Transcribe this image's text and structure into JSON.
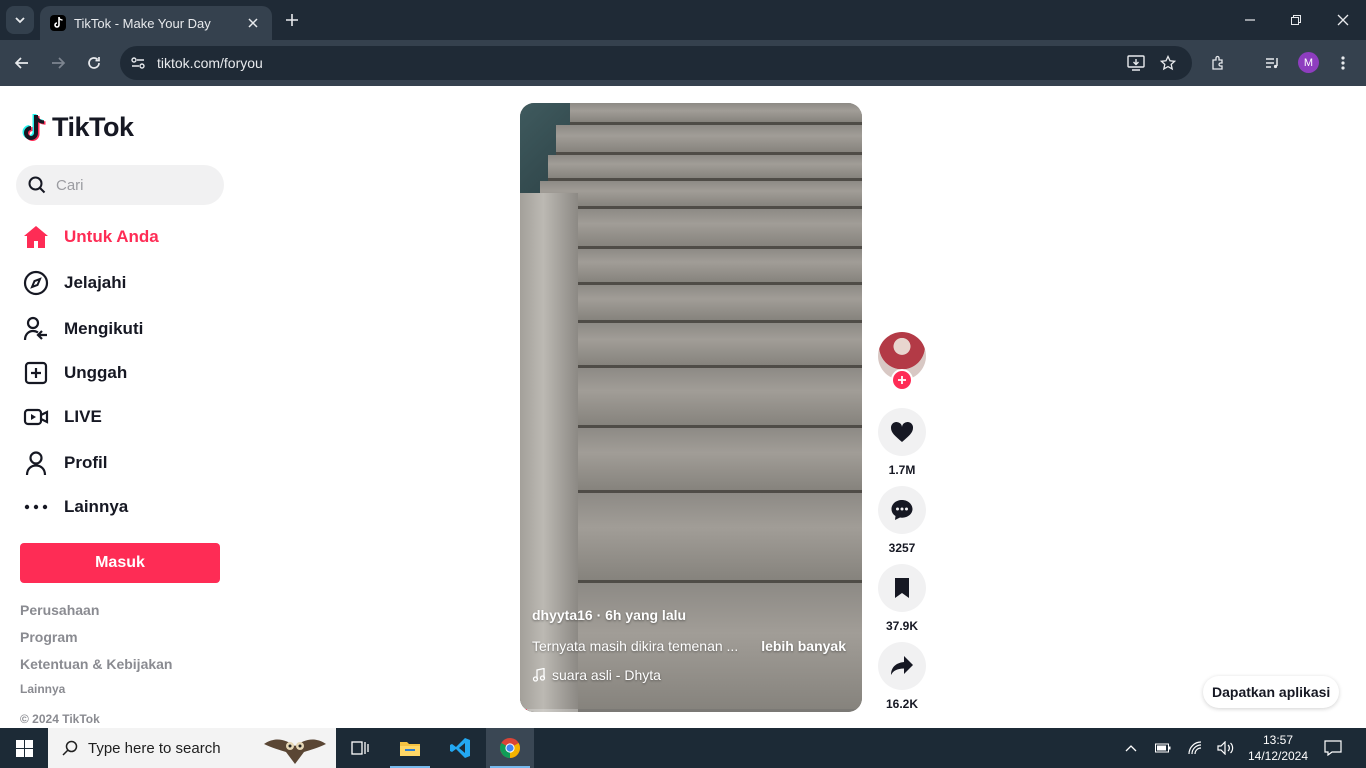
{
  "browser": {
    "tab_title": "TikTok - Make Your Day",
    "url": "tiktok.com/foryou",
    "profile_initial": "M"
  },
  "sidebar": {
    "logo_text": "TikTok",
    "search_placeholder": "Cari",
    "items": [
      {
        "label": "Untuk Anda",
        "icon": "home-icon",
        "active": true
      },
      {
        "label": "Jelajahi",
        "icon": "compass-icon"
      },
      {
        "label": "Mengikuti",
        "icon": "following-icon"
      },
      {
        "label": "Unggah",
        "icon": "upload-icon"
      },
      {
        "label": "LIVE",
        "icon": "live-icon"
      },
      {
        "label": "Profil",
        "icon": "profile-icon"
      },
      {
        "label": "Lainnya",
        "icon": "more-icon"
      }
    ],
    "login_label": "Masuk",
    "footer_links": [
      "Perusahaan",
      "Program",
      "Ketentuan & Kebijakan"
    ],
    "footer_more": "Lainnya",
    "copyright": "© 2024 TikTok"
  },
  "video": {
    "author_line": "dhyyta16 · 6h yang lalu",
    "description": "Ternyata masih dikira temenan ...",
    "more_label": "lebih banyak",
    "music": "suara asli - Dhyta",
    "progress": 0.02
  },
  "actions": {
    "likes": "1.7M",
    "comments": "3257",
    "bookmarks": "37.9K",
    "shares": "16.2K"
  },
  "get_app_label": "Dapatkan aplikasi",
  "taskbar": {
    "search_text": "Type here to search",
    "time": "13:57",
    "date": "14/12/2024"
  },
  "colors": {
    "brand": "#fe2c55",
    "chrome_dark": "#1f2a36",
    "chrome_toolbar": "#35414e"
  }
}
